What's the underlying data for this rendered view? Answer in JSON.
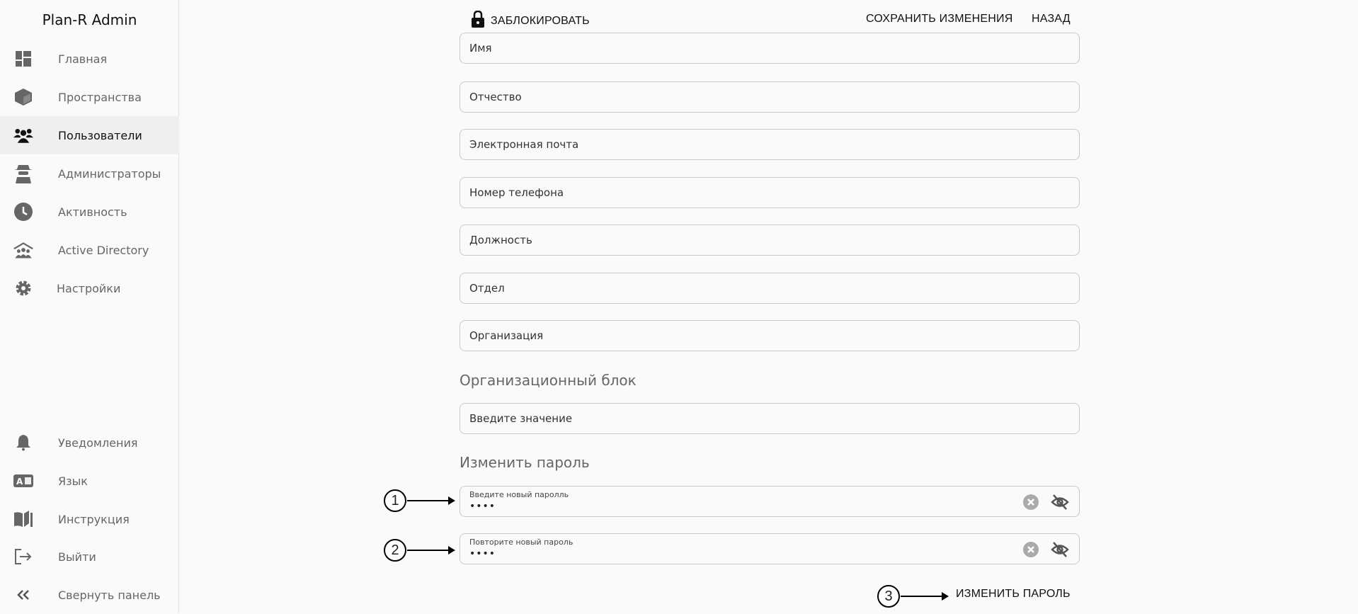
{
  "app_title": "Plan-R Admin",
  "sidebar": {
    "items": [
      {
        "label": "Главная",
        "icon": "dashboard-icon"
      },
      {
        "label": "Пространства",
        "icon": "cube-icon"
      },
      {
        "label": "Пользователи",
        "icon": "users-icon",
        "active": true
      },
      {
        "label": "Администраторы",
        "icon": "admin-spy-icon"
      },
      {
        "label": "Активность",
        "icon": "clock-icon"
      },
      {
        "label": "Active Directory",
        "icon": "house-users-icon"
      },
      {
        "label": "Настройки",
        "icon": "gear-icon"
      }
    ],
    "bottom": [
      {
        "label": "Уведомления",
        "icon": "bell-icon"
      },
      {
        "label": "Язык",
        "icon": "language-icon"
      },
      {
        "label": "Инструкция",
        "icon": "book-icon"
      },
      {
        "label": "Выйти",
        "icon": "logout-icon"
      },
      {
        "label": "Свернуть панель",
        "icon": "chevrons-left-icon"
      }
    ]
  },
  "toolbar": {
    "lock": "ЗАБЛОКИРОВАТЬ",
    "save": "СОХРАНИТЬ ИЗМЕНЕНИЯ",
    "back": "НАЗАД"
  },
  "form": {
    "fields": [
      "Имя",
      "Отчество",
      "Электронная почта",
      "Номер телефона",
      "Должность",
      "Отдел",
      "Организация"
    ],
    "org_block_title": "Организационный блок",
    "org_block_placeholder": "Введите значение",
    "password_title": "Изменить пароль",
    "new_password_label": "Введите новый паролль",
    "new_password_value": "••••",
    "repeat_password_label": "Повторите новый пароль",
    "repeat_password_value": "••••",
    "change_password_button": "ИЗМЕНИТЬ ПАРОЛЬ"
  },
  "callouts": [
    "1",
    "2",
    "3"
  ]
}
